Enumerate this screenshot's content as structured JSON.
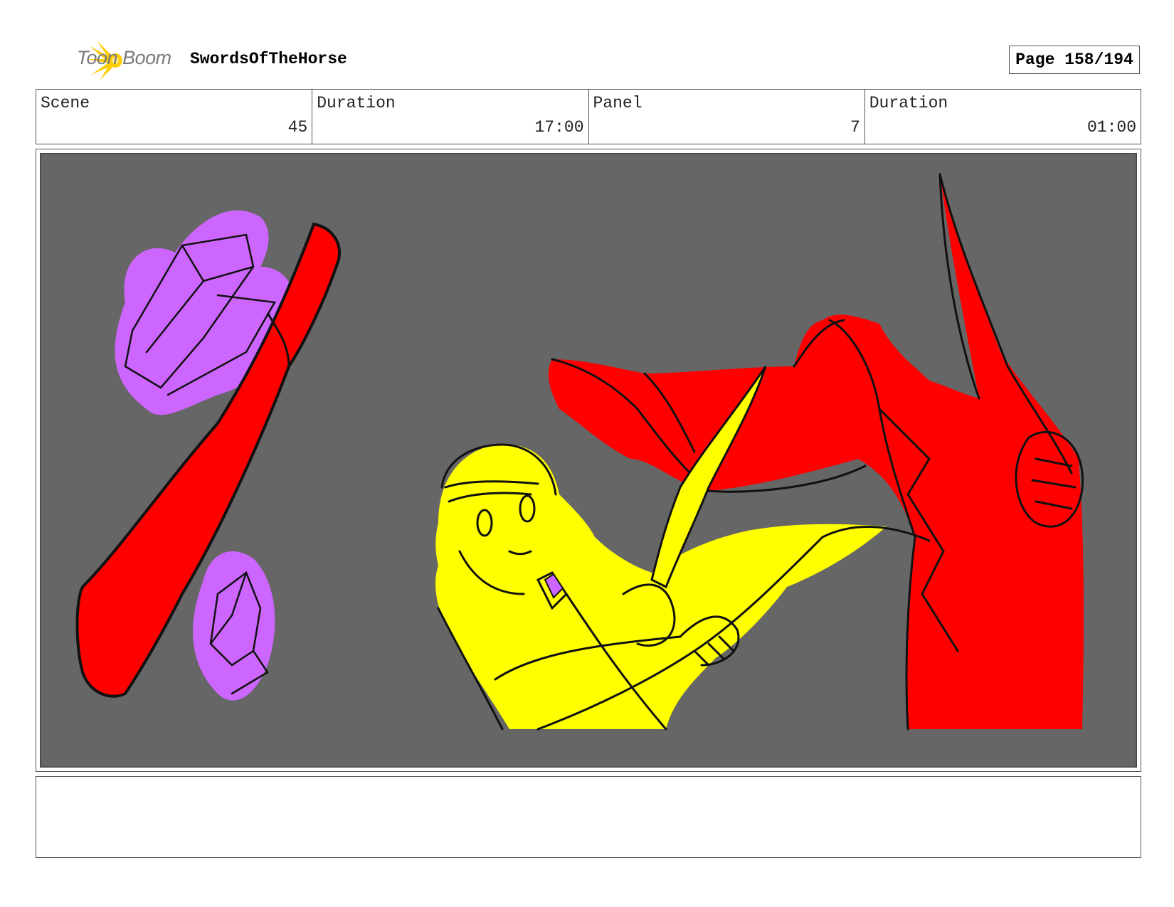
{
  "header": {
    "logo_text": "Toon Boom",
    "project_title": "SwordsOfTheHorse",
    "page_label": "Page 158/194"
  },
  "info": {
    "scene_label": "Scene",
    "scene_value": "45",
    "scene_duration_label": "Duration",
    "scene_duration_value": "17:00",
    "panel_label": "Panel",
    "panel_value": "7",
    "panel_duration_label": "Duration",
    "panel_duration_value": "01:00"
  },
  "colors": {
    "background": "#666666",
    "red": "#ff0000",
    "yellow": "#ffff00",
    "purple": "#cc66ff",
    "logo_yellow": "#ffcc00"
  },
  "notes": ""
}
